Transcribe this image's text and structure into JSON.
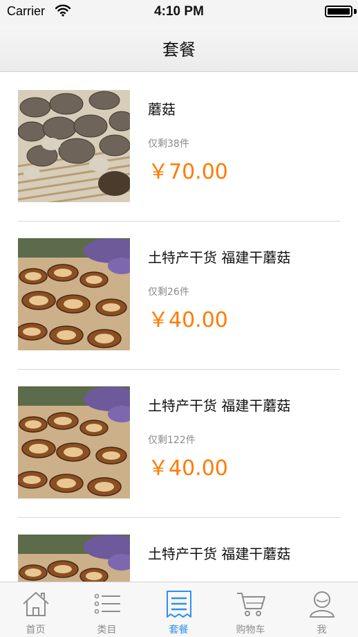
{
  "status_bar": {
    "carrier": "Carrier",
    "time": "4:10 PM"
  },
  "nav": {
    "title": "套餐"
  },
  "products": [
    {
      "name": "蘑菇",
      "stock": "仅剩38件",
      "price": "￥70.00",
      "image": "mushroom-pile-image"
    },
    {
      "name": "土特产干货 福建干蘑菇",
      "stock": "仅剩26件",
      "price": "￥40.00",
      "image": "dried-mushroom-image"
    },
    {
      "name": "土特产干货 福建干蘑菇",
      "stock": "仅剩122件",
      "price": "￥40.00",
      "image": "dried-mushroom-image"
    },
    {
      "name": "土特产干货 福建干蘑菇",
      "stock": "",
      "price": "",
      "image": "dried-mushroom-image"
    }
  ],
  "tabs": [
    {
      "label": "首页",
      "icon": "home-icon",
      "active": false
    },
    {
      "label": "类目",
      "icon": "list-icon",
      "active": false
    },
    {
      "label": "套餐",
      "icon": "package-icon",
      "active": true
    },
    {
      "label": "购物车",
      "icon": "cart-icon",
      "active": false
    },
    {
      "label": "我",
      "icon": "user-icon",
      "active": false
    }
  ],
  "colors": {
    "price": "#ff7a00",
    "active_tab": "#2d8ff0",
    "inactive_tab": "#8c8c8c"
  }
}
